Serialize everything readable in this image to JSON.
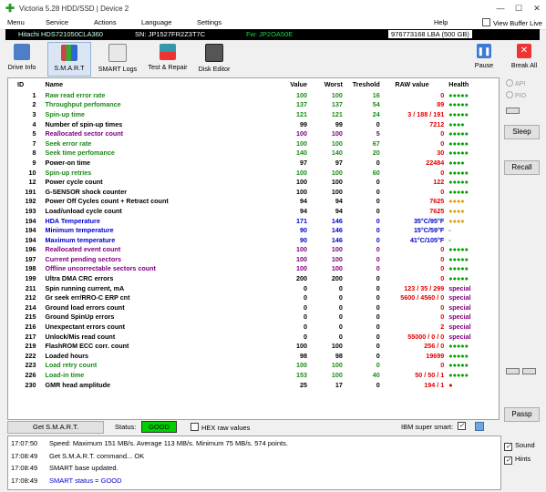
{
  "window": {
    "title": "Victoria 5.28 HDD/SSD | Device 2"
  },
  "menu": {
    "items": [
      "Menu",
      "Service",
      "Actions",
      "Language",
      "Settings"
    ],
    "help": "Help",
    "view_buffer": "View Buffer Live"
  },
  "drive": {
    "model": "Hitachi HDS721050CLA360",
    "serial": "SN: JP1527FR2Z3T7C",
    "firmware": "Fw: JP2OA50E",
    "capacity": "976773168 LBA (500 GB)"
  },
  "toolbar": {
    "drive_info": "Drive Info",
    "smart": "S.M.A.R.T",
    "smart_logs": "SMART Logs",
    "test_repair": "Test & Repair",
    "disk_editor": "Disk Editor",
    "pause": "Pause",
    "break_all": "Break All"
  },
  "columns": {
    "id": "ID",
    "name": "Name",
    "value": "Value",
    "worst": "Worst",
    "treshold": "Treshold",
    "raw": "RAW value",
    "health": "Health"
  },
  "rows": [
    {
      "id": "1",
      "name": "Raw read error rate",
      "val": "100",
      "worst": "100",
      "tres": "16",
      "raw": "0",
      "health": "●●●●●",
      "nc": "g",
      "hc": "okc"
    },
    {
      "id": "2",
      "name": "Throughput perfomance",
      "val": "137",
      "worst": "137",
      "tres": "54",
      "raw": "89",
      "health": "●●●●●",
      "nc": "g",
      "hc": "okc"
    },
    {
      "id": "3",
      "name": "Spin-up time",
      "val": "121",
      "worst": "121",
      "tres": "24",
      "raw": "3 / 188 / 191",
      "health": "●●●●●",
      "nc": "g",
      "hc": "okc"
    },
    {
      "id": "4",
      "name": "Number of spin-up times",
      "val": "99",
      "worst": "99",
      "tres": "0",
      "raw": "7212",
      "health": "●●●●",
      "nc": "k",
      "hc": "okc"
    },
    {
      "id": "5",
      "name": "Reallocated sector count",
      "val": "100",
      "worst": "100",
      "tres": "5",
      "raw": "0",
      "health": "●●●●●",
      "nc": "p",
      "hc": "okc"
    },
    {
      "id": "7",
      "name": "Seek error rate",
      "val": "100",
      "worst": "100",
      "tres": "67",
      "raw": "0",
      "health": "●●●●●",
      "nc": "g",
      "hc": "okc"
    },
    {
      "id": "8",
      "name": "Seek time perfomance",
      "val": "140",
      "worst": "140",
      "tres": "20",
      "raw": "30",
      "health": "●●●●●",
      "nc": "g",
      "hc": "okc"
    },
    {
      "id": "9",
      "name": "Power-on time",
      "val": "97",
      "worst": "97",
      "tres": "0",
      "raw": "22484",
      "health": "●●●●",
      "nc": "k",
      "hc": "okc"
    },
    {
      "id": "10",
      "name": "Spin-up retries",
      "val": "100",
      "worst": "100",
      "tres": "60",
      "raw": "0",
      "health": "●●●●●",
      "nc": "g",
      "hc": "okc"
    },
    {
      "id": "12",
      "name": "Power cycle count",
      "val": "100",
      "worst": "100",
      "tres": "0",
      "raw": "122",
      "health": "●●●●●",
      "nc": "k",
      "hc": "okc"
    },
    {
      "id": "191",
      "name": "G-SENSOR shock counter",
      "val": "100",
      "worst": "100",
      "tres": "0",
      "raw": "0",
      "health": "●●●●●",
      "nc": "k",
      "hc": "okc"
    },
    {
      "id": "192",
      "name": "Power Off Cycles count + Retract count",
      "val": "94",
      "worst": "94",
      "tres": "0",
      "raw": "7625",
      "health": "●●●●",
      "nc": "k",
      "hc": "wc"
    },
    {
      "id": "193",
      "name": "Load/unload cycle count",
      "val": "94",
      "worst": "94",
      "tres": "0",
      "raw": "7625",
      "health": "●●●●",
      "nc": "k",
      "hc": "wc"
    },
    {
      "id": "194",
      "name": "HDA Temperature",
      "val": "171",
      "worst": "146",
      "tres": "0",
      "raw": "35°C/95°F",
      "health": "●●●●",
      "nc": "b",
      "hc": "wc",
      "rc": "b"
    },
    {
      "id": "194",
      "name": "Minimum temperature",
      "val": "90",
      "worst": "146",
      "tres": "0",
      "raw": "15°C/59°F",
      "health": "-",
      "nc": "b",
      "hc": "dash",
      "rc": "b"
    },
    {
      "id": "194",
      "name": "Maximum temperature",
      "val": "90",
      "worst": "146",
      "tres": "0",
      "raw": "41°C/105°F",
      "health": "-",
      "nc": "b",
      "hc": "dash",
      "rc": "b"
    },
    {
      "id": "196",
      "name": "Reallocated event count",
      "val": "100",
      "worst": "100",
      "tres": "0",
      "raw": "0",
      "health": "●●●●●",
      "nc": "p",
      "hc": "okc"
    },
    {
      "id": "197",
      "name": "Current pending sectors",
      "val": "100",
      "worst": "100",
      "tres": "0",
      "raw": "0",
      "health": "●●●●●",
      "nc": "p",
      "hc": "okc"
    },
    {
      "id": "198",
      "name": "Offline uncorrectable sectors count",
      "val": "100",
      "worst": "100",
      "tres": "0",
      "raw": "0",
      "health": "●●●●●",
      "nc": "p",
      "hc": "okc"
    },
    {
      "id": "199",
      "name": "Ultra DMA CRC errors",
      "val": "200",
      "worst": "200",
      "tres": "0",
      "raw": "0",
      "health": "●●●●●",
      "nc": "k",
      "hc": "okc"
    },
    {
      "id": "211",
      "name": "Spin running current, mA",
      "val": "0",
      "worst": "0",
      "tres": "0",
      "raw": "123 / 35 / 299",
      "health": "special",
      "nc": "k",
      "hc": "sp"
    },
    {
      "id": "212",
      "name": "Gr seek err/RRO-C ERP cnt",
      "val": "0",
      "worst": "0",
      "tres": "0",
      "raw": "5600 / 4560 / 0",
      "health": "special",
      "nc": "k",
      "hc": "sp"
    },
    {
      "id": "214",
      "name": "Ground load errors count",
      "val": "0",
      "worst": "0",
      "tres": "0",
      "raw": "0",
      "health": "special",
      "nc": "k",
      "hc": "sp"
    },
    {
      "id": "215",
      "name": "Ground SpinUp errors",
      "val": "0",
      "worst": "0",
      "tres": "0",
      "raw": "0",
      "health": "special",
      "nc": "k",
      "hc": "sp"
    },
    {
      "id": "216",
      "name": "Unexpectant errors count",
      "val": "0",
      "worst": "0",
      "tres": "0",
      "raw": "2",
      "health": "special",
      "nc": "k",
      "hc": "sp"
    },
    {
      "id": "217",
      "name": "Unlock/Mis read count",
      "val": "0",
      "worst": "0",
      "tres": "0",
      "raw": "55000 / 0 / 0",
      "health": "special",
      "nc": "k",
      "hc": "sp"
    },
    {
      "id": "219",
      "name": "FlashROM ECC corr. count",
      "val": "100",
      "worst": "100",
      "tres": "0",
      "raw": "256 / 0",
      "health": "●●●●●",
      "nc": "k",
      "hc": "okc"
    },
    {
      "id": "222",
      "name": "Loaded hours",
      "val": "98",
      "worst": "98",
      "tres": "0",
      "raw": "19699",
      "health": "●●●●●",
      "nc": "k",
      "hc": "okc"
    },
    {
      "id": "223",
      "name": "Load retry count",
      "val": "100",
      "worst": "100",
      "tres": "0",
      "raw": "0",
      "health": "●●●●●",
      "nc": "g",
      "hc": "okc"
    },
    {
      "id": "226",
      "name": "Load-in time",
      "val": "153",
      "worst": "100",
      "tres": "40",
      "raw": "50 / 50 / 1",
      "health": "●●●●●",
      "nc": "g",
      "hc": "okc"
    },
    {
      "id": "230",
      "name": "GMR head amplitude",
      "val": "25",
      "worst": "17",
      "tres": "0",
      "raw": "194 / 1",
      "health": "●",
      "nc": "k",
      "hc": "dot"
    }
  ],
  "side": {
    "api": "API",
    "pio": "PIO",
    "sleep": "Sleep",
    "recall": "Recall",
    "passp": "Passp"
  },
  "status": {
    "get_smart": "Get S.M.A.R.T.",
    "status_label": "Status:",
    "status_value": "GOOD",
    "hex_raw": "HEX raw values",
    "ibm": "IBM super smart:"
  },
  "log": [
    {
      "time": "17:07:50",
      "msg": "Speed: Maximum 151 MB/s. Average 113 MB/s. Minimum 75 MB/s. 574 points.",
      "ok": false
    },
    {
      "time": "17:08:49",
      "msg": "Get S.M.A.R.T. command... OK",
      "ok": false
    },
    {
      "time": "17:08:49",
      "msg": "SMART base updated.",
      "ok": false
    },
    {
      "time": "17:08:49",
      "msg": "SMART status = GOOD",
      "ok": true
    }
  ],
  "log_side": {
    "sound": "Sound",
    "hints": "Hints"
  },
  "colors": {
    "good": "#00d000",
    "accent_green": "#1a8a1a",
    "purple": "#800080",
    "blue": "#0000cc"
  }
}
